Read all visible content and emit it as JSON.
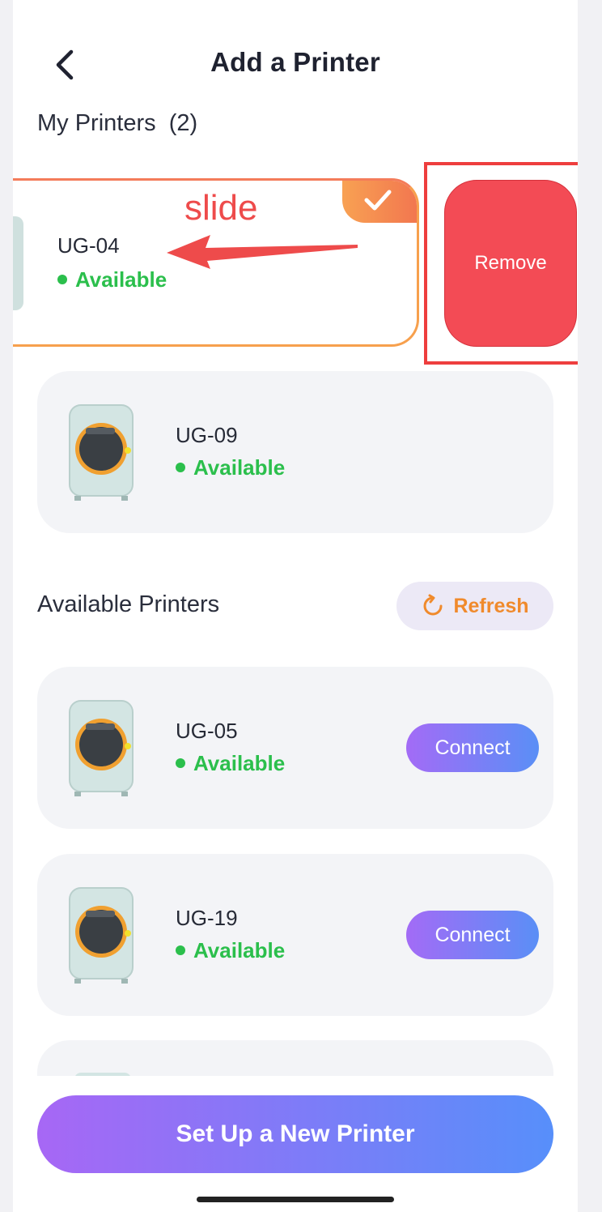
{
  "header": {
    "title": "Add a Printer"
  },
  "my_printers": {
    "title": "My Printers",
    "count": "(2)",
    "swiped_item": {
      "name": "UG-04",
      "status": "Available",
      "selected": true,
      "action_label": "Remove"
    },
    "items": [
      {
        "name": "UG-09",
        "status": "Available"
      }
    ]
  },
  "annotation": {
    "text": "slide"
  },
  "available_printers": {
    "title": "Available Printers",
    "refresh_label": "Refresh",
    "items": [
      {
        "name": "UG-05",
        "status": "Available",
        "action_label": "Connect"
      },
      {
        "name": "UG-19",
        "status": "Available",
        "action_label": "Connect"
      }
    ]
  },
  "footer": {
    "setup_label": "Set Up a New Printer"
  },
  "colors": {
    "status_green": "#2bbf4c",
    "remove_red": "#f34b55",
    "accent_orange": "#f08a2c",
    "gradient_start": "#a767f5",
    "gradient_end": "#578ffa"
  }
}
